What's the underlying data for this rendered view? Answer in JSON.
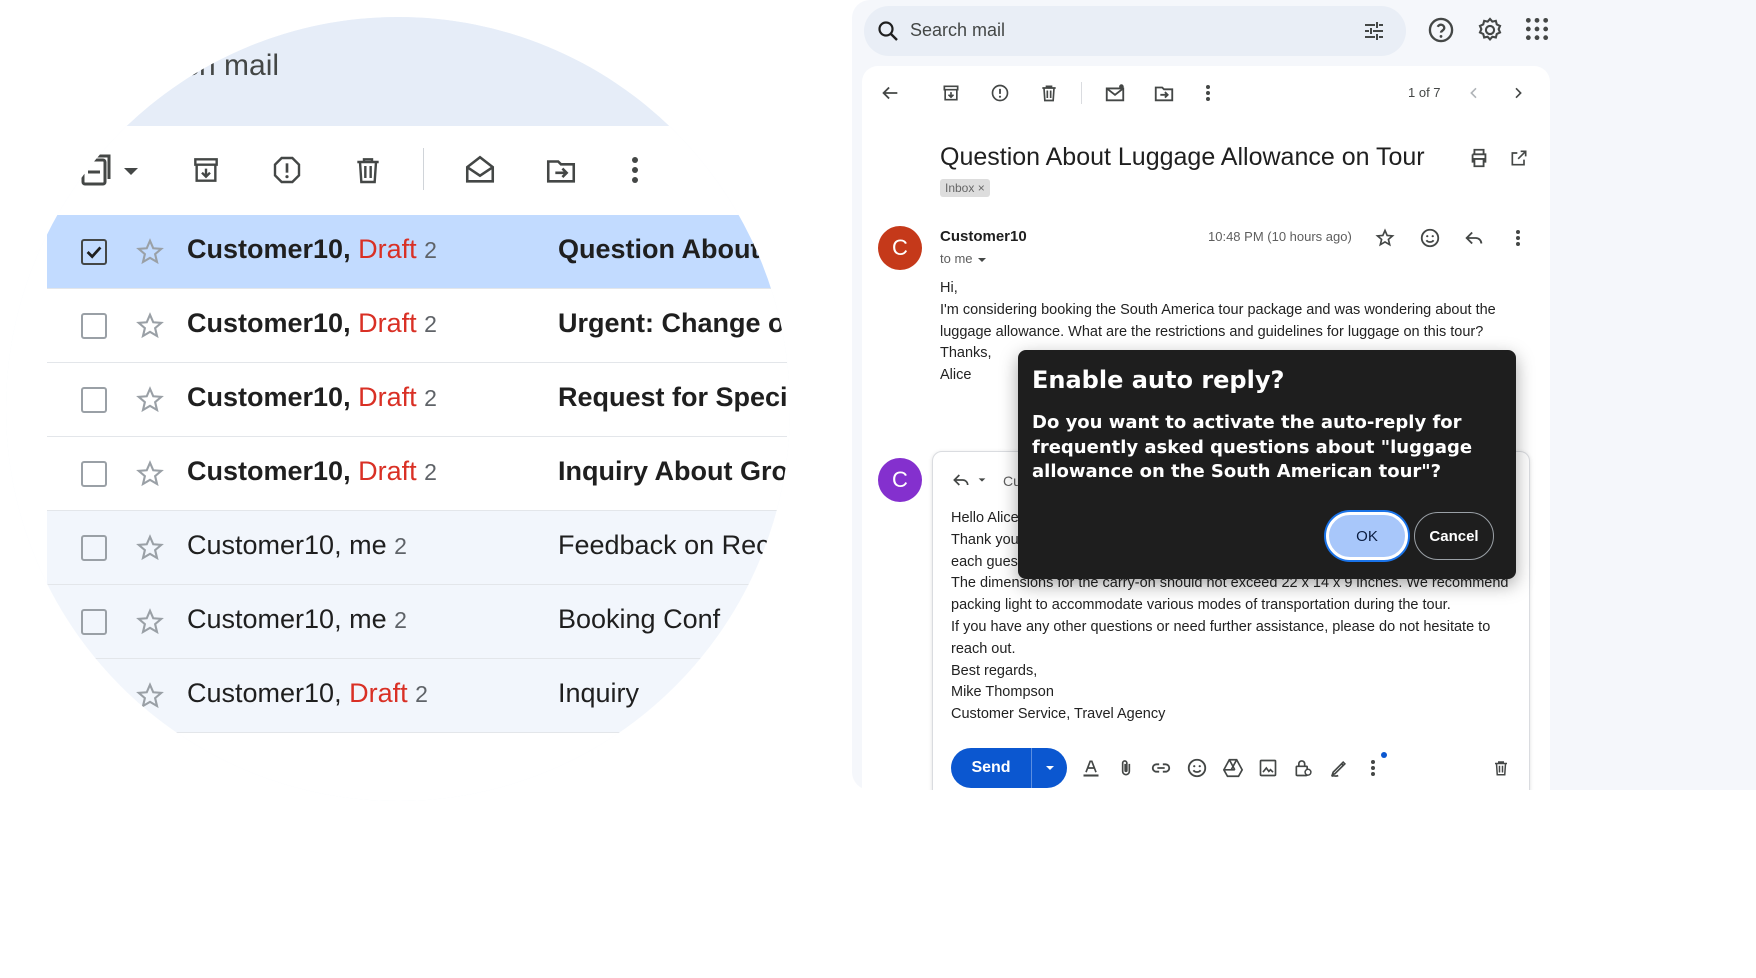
{
  "zoom": {
    "search_fragment": "ch mail",
    "rows": [
      {
        "sender": "Customer10",
        "sep": ", ",
        "draft": "Draft",
        "me": "",
        "count": "2",
        "subject": "Question About",
        "selected": true,
        "unread": true
      },
      {
        "sender": "Customer10",
        "sep": ", ",
        "draft": "Draft",
        "me": "",
        "count": "2",
        "subject": "Urgent: Change o",
        "selected": false,
        "unread": true
      },
      {
        "sender": "Customer10",
        "sep": ", ",
        "draft": "Draft",
        "me": "",
        "count": "2",
        "subject": "Request for Speci",
        "selected": false,
        "unread": true
      },
      {
        "sender": "Customer10",
        "sep": ", ",
        "draft": "Draft",
        "me": "",
        "count": "2",
        "subject": "Inquiry About Gro",
        "selected": false,
        "unread": true
      },
      {
        "sender": "Customer10",
        "sep": ", ",
        "draft": "",
        "me": "me",
        "count": "2",
        "subject": "Feedback on Rec",
        "selected": false,
        "unread": false
      },
      {
        "sender": "Customer10",
        "sep": ", ",
        "draft": "",
        "me": "me",
        "count": "2",
        "subject": "Booking Conf",
        "selected": false,
        "unread": false
      },
      {
        "sender": "Customer10",
        "sep": ", ",
        "draft": "Draft",
        "me": "",
        "count": "2",
        "subject": "Inquiry",
        "selected": false,
        "unread": false
      }
    ]
  },
  "search": {
    "placeholder": "Search mail"
  },
  "pager": "1 of 7",
  "email": {
    "subject": "Question About Luggage Allowance on Tour",
    "label": "Inbox ×",
    "from": "Customer10",
    "to": "to me",
    "time": "10:48 PM (10 hours ago)",
    "avatar_letter": "C",
    "avatar_color": "#c5391a",
    "body": [
      "Hi,",
      "I'm considering booking the South America tour package and was wondering about the",
      "luggage allowance. What are the restrictions and guidelines for luggage on this tour?",
      "Thanks,",
      "Alice"
    ]
  },
  "reply": {
    "avatar_letter": "C",
    "avatar_color": "#8430ce",
    "to_fragment": "Cu",
    "body": [
      "Hello Alice",
      "Thank you",
      "each gues",
      "The dimensions for the carry-on should not exceed 22 x 14 x 9 inches. We recommend",
      "packing light to accommodate various modes of transportation during the tour.",
      "If you have any other questions or need further assistance, please do not hesitate to",
      "reach out.",
      "Best regards,",
      "Mike Thompson",
      "Customer Service, Travel Agency"
    ],
    "send_label": "Send"
  },
  "dialog": {
    "title": "Enable auto reply?",
    "message": "Do you want to activate the auto-reply for frequently asked questions about \"luggage allowance on the South American tour\"?",
    "ok_label": "OK",
    "cancel_label": "Cancel"
  },
  "colors": {
    "accent": "#0b57d0",
    "draft": "#d93025",
    "selected_row": "#c2dbff"
  }
}
